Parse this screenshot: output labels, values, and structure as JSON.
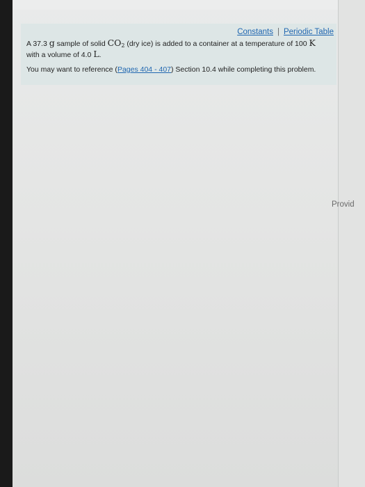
{
  "header": {
    "constants_label": "Constants",
    "separator": "|",
    "periodic_table_label": "Periodic Table"
  },
  "problem": {
    "part1": "A 37.3 ",
    "unit_g": "g",
    "part2": " sample of solid ",
    "formula_base": "CO",
    "formula_sub": "2",
    "part3": " (dry ice) is added to a container at a temperature of 100 ",
    "unit_k": "K",
    "part4": " with a volume of 4.0 ",
    "unit_l": "L",
    "part5": "."
  },
  "reference": {
    "prefix": "You may want to reference (",
    "link_label": "Pages 404 - 407",
    "suffix": ") Section 10.4 while completing this problem."
  },
  "right_pane": {
    "button_label": "Provid"
  }
}
